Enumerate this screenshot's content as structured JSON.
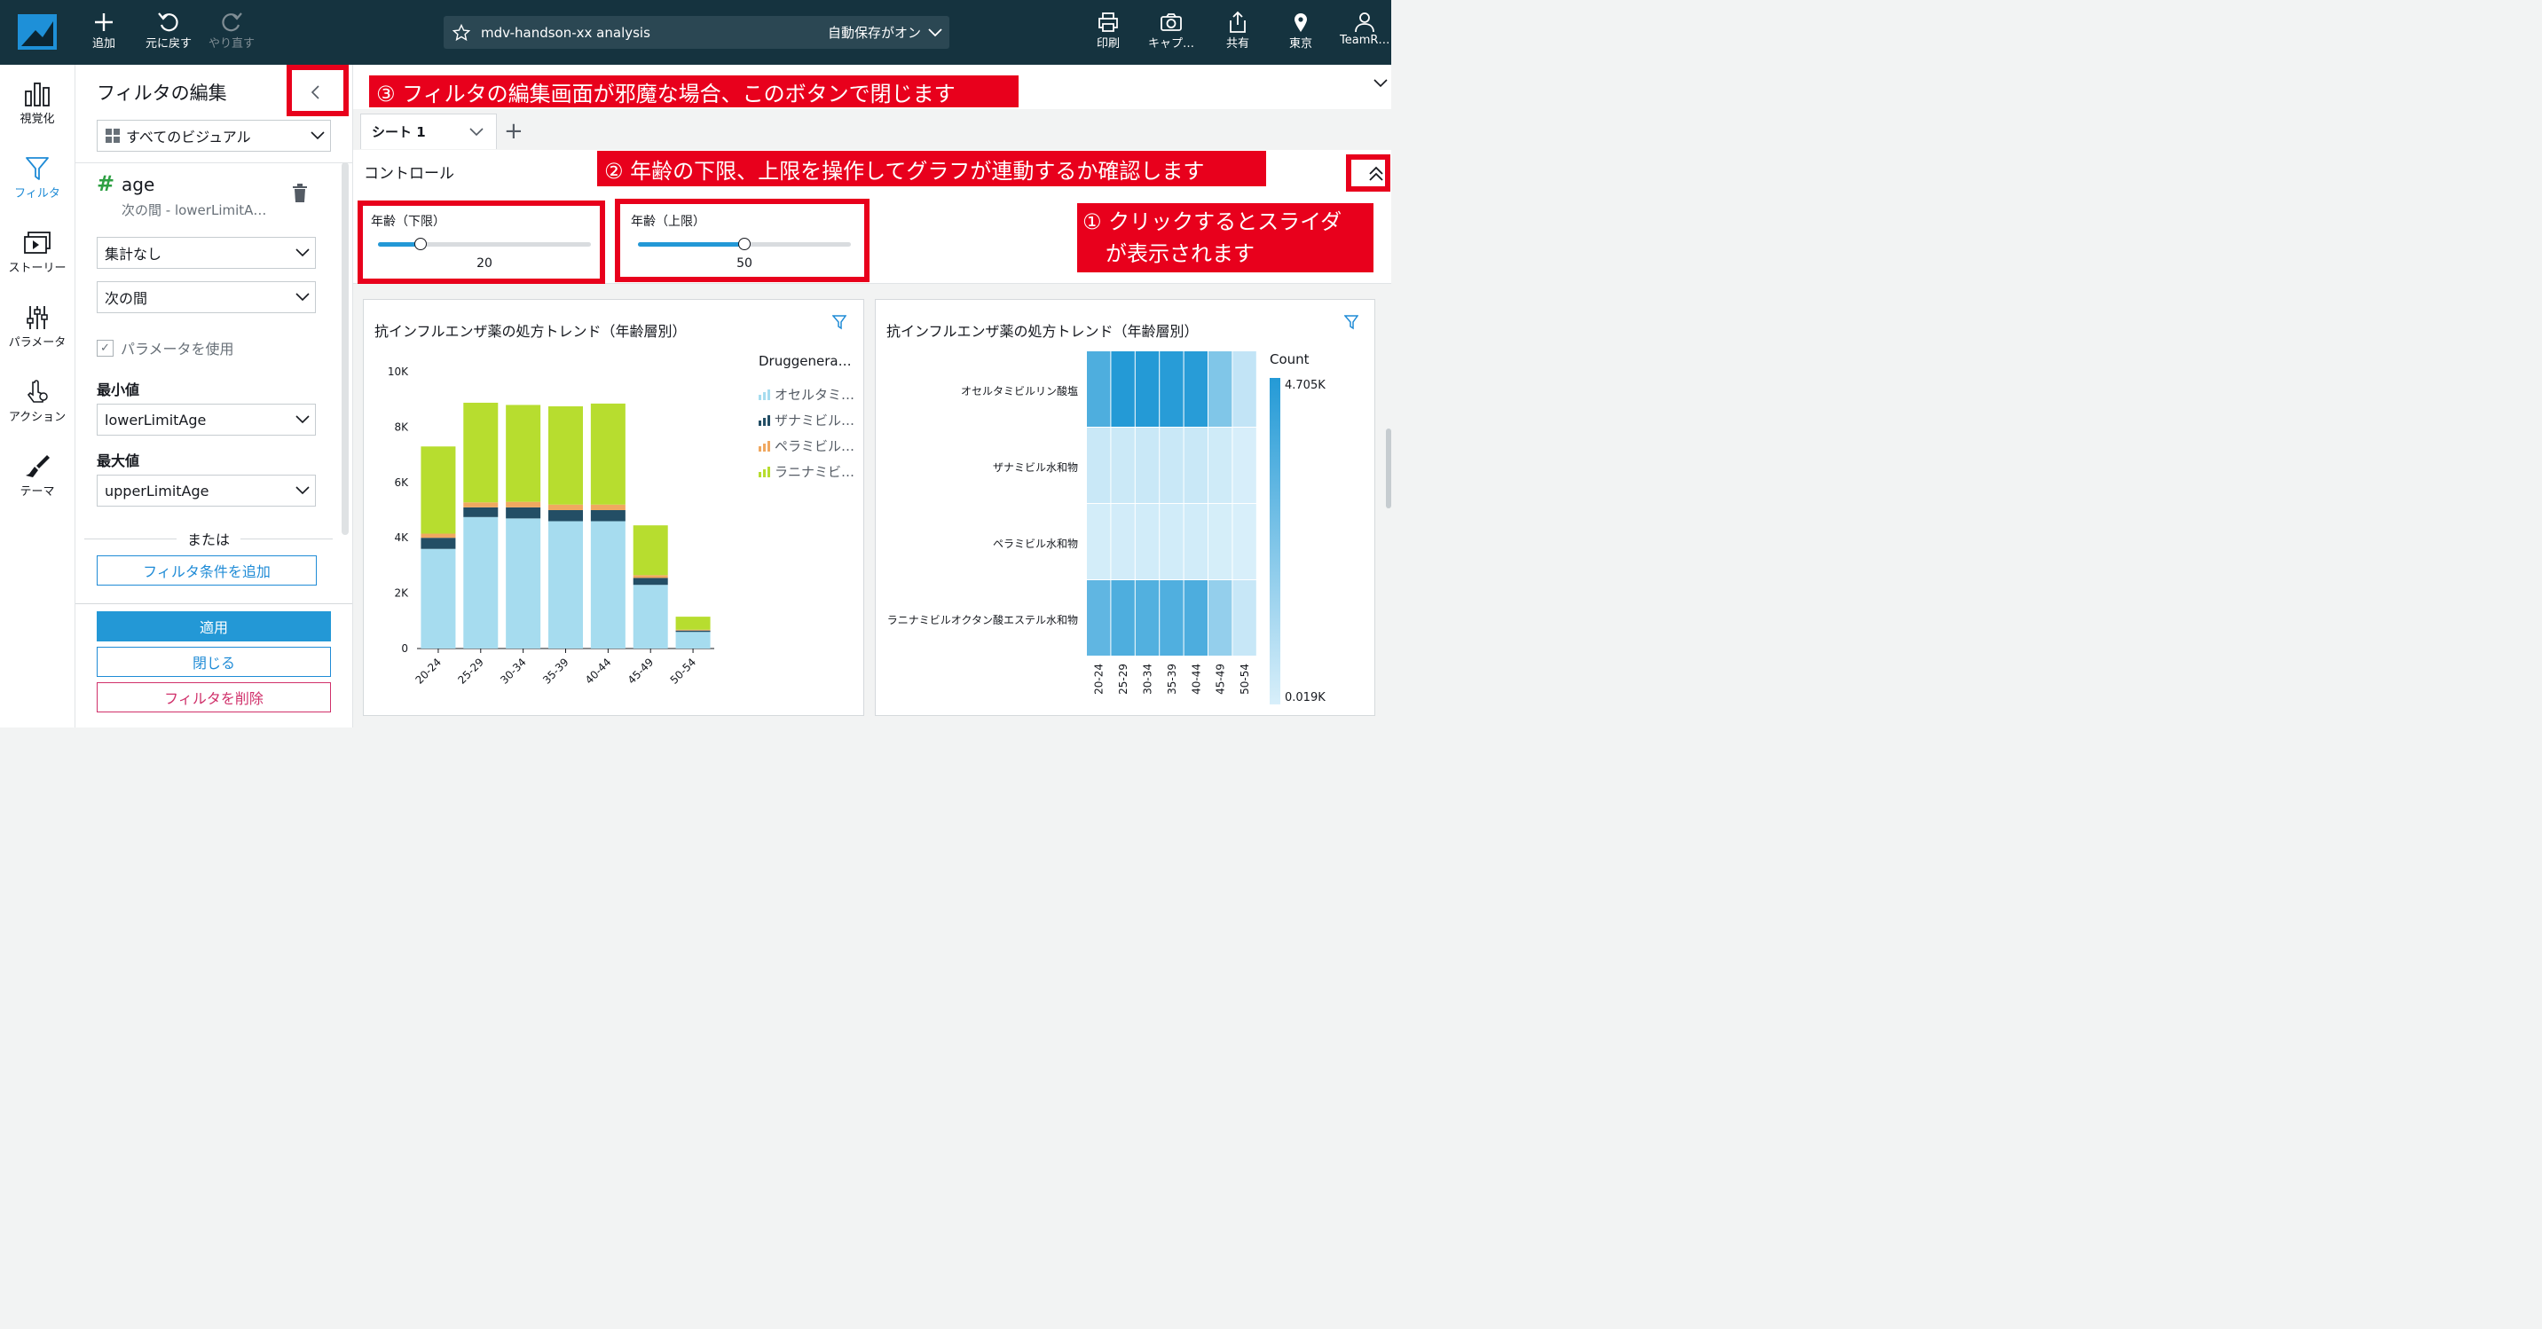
{
  "topbar": {
    "add": "追加",
    "undo": "元に戻す",
    "redo": "やり直す",
    "analysis_name": "mdv-handson-xx analysis",
    "autosave": "自動保存がオン",
    "print": "印刷",
    "capture": "キャプ…",
    "share": "共有",
    "region": "東京",
    "user": "TeamR…"
  },
  "leftnav": {
    "items": [
      {
        "label": "視覚化",
        "icon": "bar-chart-icon"
      },
      {
        "label": "フィルタ",
        "icon": "filter-icon"
      },
      {
        "label": "ストーリー",
        "icon": "story-icon"
      },
      {
        "label": "パラメータ",
        "icon": "sliders-icon"
      },
      {
        "label": "アクション",
        "icon": "action-icon"
      },
      {
        "label": "テーマ",
        "icon": "brush-icon"
      }
    ]
  },
  "filter_panel": {
    "title": "フィルタの編集",
    "scope": "すべてのビジュアル",
    "field_name": "age",
    "field_desc": "次の間 - lowerLimitA…",
    "aggregation": "集計なし",
    "condition": "次の間",
    "use_params": "パラメータを使用",
    "min_label": "最小値",
    "min_value": "lowerLimitAge",
    "max_label": "最大値",
    "max_value": "upperLimitAge",
    "or": "または",
    "add_condition": "フィルタ条件を追加",
    "apply": "適用",
    "close": "閉じる",
    "delete": "フィルタを削除"
  },
  "sheet": {
    "tab": "シート 1",
    "controls_title": "コントロール"
  },
  "sliders": [
    {
      "label": "年齢（下限）",
      "value": "20",
      "fraction": 0.2
    },
    {
      "label": "年齢（上限）",
      "value": "50",
      "fraction": 0.5
    }
  ],
  "annotations": {
    "a1_line1": "① クリックするとスライダ",
    "a1_line2": "が表示されます",
    "a2": "② 年齢の下限、上限を操作してグラフが連動するか確認します",
    "a3": "③ フィルタの編集画面が邪魔な場合、このボタンで閉じます"
  },
  "visual1": {
    "title": "抗インフルエンザ薬の処方トレンド（年齢層別）",
    "legend_title": "Druggenera…",
    "legend": [
      "オセルタミ…",
      "ザナミビル…",
      "ペラミビル…",
      "ラニナミビ…"
    ]
  },
  "visual2": {
    "title": "抗インフルエンザ薬の処方トレンド（年齢層別）",
    "rows": [
      "オセルタミビルリン酸塩",
      "ザナミビル水和物",
      "ペラミビル水和物",
      "ラニナミビルオクタン酸エステル水和物"
    ],
    "count_label": "Count",
    "max_label": "4.705K",
    "min_label": "0.019K"
  },
  "colors": {
    "oseltamivir": "#a6dcef",
    "zanamivir": "#234e65",
    "peramivir": "#f0a860",
    "laninamivir": "#b7dd2f",
    "accent": "#1f8bd6",
    "annotation": "#e8001c"
  },
  "chart_data": [
    {
      "type": "bar",
      "stacked": true,
      "title": "抗インフルエンザ薬の処方トレンド（年齢層別）",
      "categories": [
        "20-24",
        "25-29",
        "30-34",
        "35-39",
        "40-44",
        "45-49",
        "50-54"
      ],
      "ylim": [
        0,
        10000
      ],
      "yticks": [
        "0",
        "2K",
        "4K",
        "6K",
        "8K",
        "10K"
      ],
      "ytick_values": [
        0,
        2000,
        4000,
        6000,
        8000,
        10000
      ],
      "series": [
        {
          "name": "オセルタミ…",
          "values": [
            3600,
            4750,
            4700,
            4600,
            4600,
            2300,
            600
          ]
        },
        {
          "name": "ザナミビル…",
          "values": [
            400,
            350,
            400,
            400,
            400,
            250,
            50
          ]
        },
        {
          "name": "ペラミビル…",
          "values": [
            150,
            180,
            200,
            200,
            200,
            100,
            30
          ]
        },
        {
          "name": "ラニナミビ…",
          "values": [
            3150,
            3600,
            3500,
            3550,
            3650,
            1800,
            470
          ]
        }
      ],
      "grid": false
    },
    {
      "type": "heatmap",
      "title": "抗インフルエンザ薬の処方トレンド（年齢層別）",
      "x": [
        "20-24",
        "25-29",
        "30-34",
        "35-39",
        "40-44",
        "45-49",
        "50-54"
      ],
      "y": [
        "オセルタミビルリン酸塩",
        "ザナミビル水和物",
        "ペラミビル水和物",
        "ラニナミビルオクタン酸エステル水和物"
      ],
      "values": [
        [
          3600,
          4705,
          4700,
          4600,
          4600,
          2300,
          600
        ],
        [
          400,
          350,
          400,
          400,
          400,
          250,
          50
        ],
        [
          150,
          180,
          200,
          200,
          200,
          100,
          30
        ],
        [
          3150,
          3600,
          3500,
          3550,
          3650,
          1800,
          470
        ]
      ],
      "color_range": [
        19,
        4705
      ],
      "legend_title": "Count"
    }
  ]
}
